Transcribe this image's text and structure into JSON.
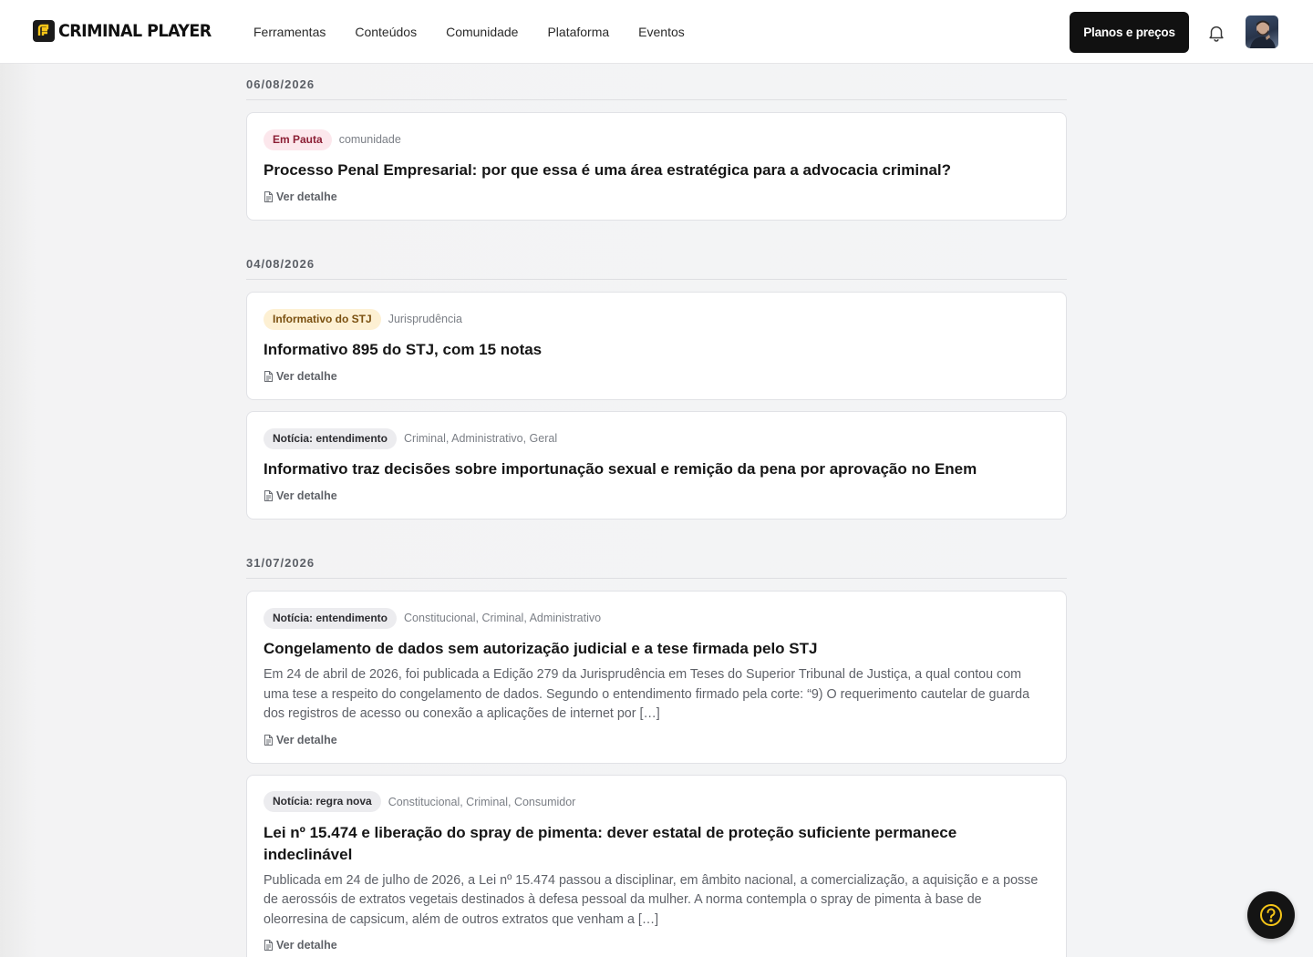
{
  "header": {
    "logo_text": "CRIMINAL PLAYER",
    "nav": [
      "Ferramentas",
      "Conteúdos",
      "Comunidade",
      "Plataforma",
      "Eventos"
    ],
    "plans_label": "Planos e preços"
  },
  "feed": [
    {
      "date": "06/08/2026",
      "items": [
        {
          "badge": "Em Pauta",
          "badge_color": "#fce7ec",
          "categories": "comunidade",
          "title": "Processo Penal Empresarial: por que essa é uma área estratégica para a advocacia criminal?",
          "excerpt": "",
          "more_label": "Ver detalhe"
        }
      ]
    },
    {
      "date": "04/08/2026",
      "items": [
        {
          "badge": "Informativo do STJ",
          "badge_color": "#fdf0d3",
          "categories": "Jurisprudência",
          "title": "Informativo 895 do STJ, com 15 notas",
          "excerpt": "",
          "more_label": "Ver detalhe"
        },
        {
          "badge": "Notícia: entendimento",
          "badge_color": "#ececef",
          "categories": "Criminal, Administrativo, Geral",
          "title": "Informativo traz decisões sobre importunação sexual e remição da pena por aprovação no Enem",
          "excerpt": "",
          "more_label": "Ver detalhe"
        }
      ]
    },
    {
      "date": "31/07/2026",
      "items": [
        {
          "badge": "Notícia: entendimento",
          "badge_color": "#ececef",
          "categories": "Constitucional, Criminal, Administrativo",
          "title": "Congelamento de dados sem autorização judicial e a tese firmada pelo STJ",
          "excerpt": "Em 24 de abril de 2026, foi publicada a Edição 279 da Jurisprudência em Teses do Superior Tribunal de Justiça, a qual contou com uma tese a respeito do congelamento de dados. Segundo o entendimento firmado pela corte: “9) O requerimento cautelar de guarda dos registros de acesso ou conexão a aplicações de internet por […]",
          "more_label": "Ver detalhe"
        },
        {
          "badge": "Notícia: regra nova",
          "badge_color": "#ececef",
          "categories": "Constitucional, Criminal, Consumidor",
          "title": "Lei nº 15.474 e liberação do spray de pimenta: dever estatal de proteção suficiente permanece indeclinável",
          "excerpt": "Publicada em 24 de julho de 2026, a Lei nº 15.474 passou a disciplinar, em âmbito nacional, a comercialização, a aquisição e a posse de aerossóis de extratos vegetais destinados à defesa pessoal da mulher. A norma contempla o spray de pimenta à base de oleorresina de capsicum, além de outros extratos que venham a […]",
          "more_label": "Ver detalhe"
        }
      ]
    }
  ],
  "icons": {
    "logo": "criminal-player-logo-icon",
    "bell": "bell-icon",
    "avatar": "user-avatar",
    "doc": "document-icon",
    "help": "help-question-icon"
  },
  "colors": {
    "accent": "#f5c518",
    "dark": "#111111"
  }
}
